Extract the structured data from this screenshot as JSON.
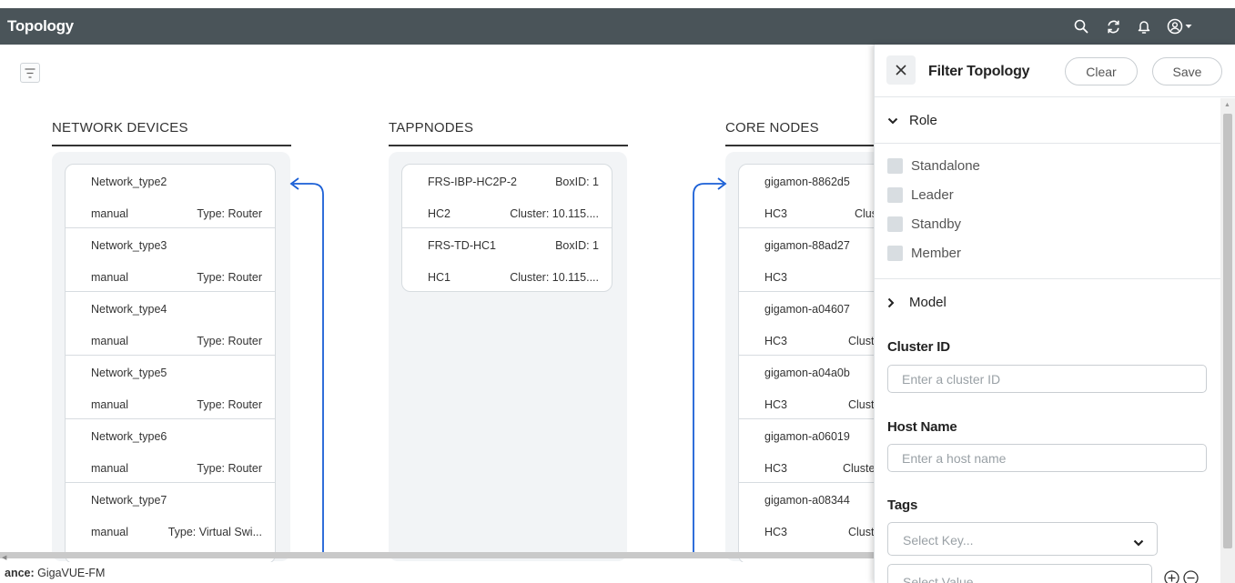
{
  "topbar": {
    "title": "Topology",
    "icons": [
      "search-icon",
      "refresh-icon",
      "bell-icon",
      "user-account-icon",
      "caret-down-icon"
    ]
  },
  "columns": [
    {
      "header": "NETWORK DEVICES",
      "cards": [
        {
          "name": "Network_type2",
          "right_top": "",
          "source": "manual",
          "type": "Type: Router"
        },
        {
          "name": "Network_type3",
          "right_top": "",
          "source": "manual",
          "type": "Type: Router"
        },
        {
          "name": "Network_type4",
          "right_top": "",
          "source": "manual",
          "type": "Type: Router"
        },
        {
          "name": "Network_type5",
          "right_top": "",
          "source": "manual",
          "type": "Type: Router"
        },
        {
          "name": "Network_type6",
          "right_top": "",
          "source": "manual",
          "type": "Type: Router"
        },
        {
          "name": "Network_type7",
          "right_top": "",
          "source": "manual",
          "type": "Type: Virtual Swi..."
        }
      ]
    },
    {
      "header": "TAPPNODES",
      "cards": [
        {
          "name": "FRS-IBP-HC2P-2",
          "right_top": "BoxID: 1",
          "source": "HC2",
          "type": "Cluster: 10.115...."
        },
        {
          "name": "FRS-TD-HC1",
          "right_top": "BoxID: 1",
          "source": "HC1",
          "type": "Cluster: 10.115...."
        }
      ]
    },
    {
      "header": "CORE NODES",
      "cards": [
        {
          "name": "gigamon-8862d5",
          "right_top": "",
          "source": "HC3",
          "type": "Clus"
        },
        {
          "name": "gigamon-88ad27",
          "right_top": "",
          "source": "HC3",
          "type": ""
        },
        {
          "name": "gigamon-a04607",
          "right_top": "",
          "source": "HC3",
          "type": "Clust"
        },
        {
          "name": "gigamon-a04a0b",
          "right_top": "",
          "source": "HC3",
          "type": "Clust"
        },
        {
          "name": "gigamon-a06019",
          "right_top": "",
          "source": "HC3",
          "type": "Cluste"
        },
        {
          "name": "gigamon-a08344",
          "right_top": "",
          "source": "HC3",
          "type": "Clust"
        }
      ]
    }
  ],
  "footer": {
    "label": "ance:",
    "value": "GigaVUE-FM"
  },
  "filter_panel": {
    "title": "Filter Topology",
    "clear_label": "Clear",
    "save_label": "Save",
    "role": {
      "title": "Role",
      "expanded": true,
      "options": [
        {
          "label": "Standalone",
          "checked": false
        },
        {
          "label": "Leader",
          "checked": false
        },
        {
          "label": "Standby",
          "checked": false
        },
        {
          "label": "Member",
          "checked": false
        }
      ]
    },
    "model": {
      "title": "Model",
      "expanded": false
    },
    "cluster_id": {
      "label": "Cluster ID",
      "placeholder": "Enter a cluster ID",
      "value": ""
    },
    "host_name": {
      "label": "Host Name",
      "placeholder": "Enter a host name",
      "value": ""
    },
    "tags": {
      "label": "Tags",
      "key_placeholder": "Select Key...",
      "value_placeholder": "Select Value"
    }
  },
  "colors": {
    "topbar": "#4a5459",
    "connector": "#1a5fd6",
    "column_bg": "#f2f4f6",
    "checkbox": "#d8dde1"
  }
}
